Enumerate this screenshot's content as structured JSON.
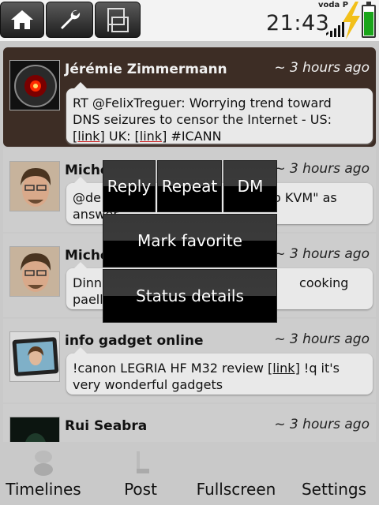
{
  "status": {
    "time": "21:43",
    "carrier": "voda P"
  },
  "toolbar": {
    "home_icon": "home-icon",
    "tools_icon": "wrench-icon",
    "switch_icon": "chair-icon"
  },
  "tweets": [
    {
      "author": "Jérémie Zimmermann",
      "time": "~ 3 hours ago",
      "text_line1": "RT @FelixTreguer: Worrying trend toward",
      "text_line2": "DNS seizures to censor the Internet - US:",
      "link1": "[link]",
      "mid": " UK: ",
      "link2": "[link]",
      "tail": " #ICANN"
    },
    {
      "author": "Miche",
      "time": "~ 3 hours ago",
      "text_a": "@de",
      "text_b": "o KVM\" as",
      "text_c": "answer"
    },
    {
      "author": "Miche",
      "time": "~ 3 hours ago",
      "text_a": "Dinn",
      "text_b": "cooking",
      "text_c": "paell"
    },
    {
      "author": "info gadget online",
      "time": "~ 3 hours ago",
      "text_pre": "!canon LEGRIA HF M32 review ",
      "link": "[link]",
      "text_post": " !q it's",
      "text_line2": "very wonderful gadgets"
    },
    {
      "author": "Rui Seabra",
      "time": "~ 3 hours ago"
    }
  ],
  "menu": {
    "reply": "Reply",
    "repeat": "Repeat",
    "dm": "DM",
    "favorite": "Mark favorite",
    "details": "Status details"
  },
  "nav": {
    "timelines": "Timelines",
    "post": "Post",
    "fullscreen": "Fullscreen",
    "settings": "Settings"
  },
  "colors": {
    "selected_row": "#3d2d25",
    "battery": "#1aa51a",
    "bolt": "#f2c01a"
  }
}
